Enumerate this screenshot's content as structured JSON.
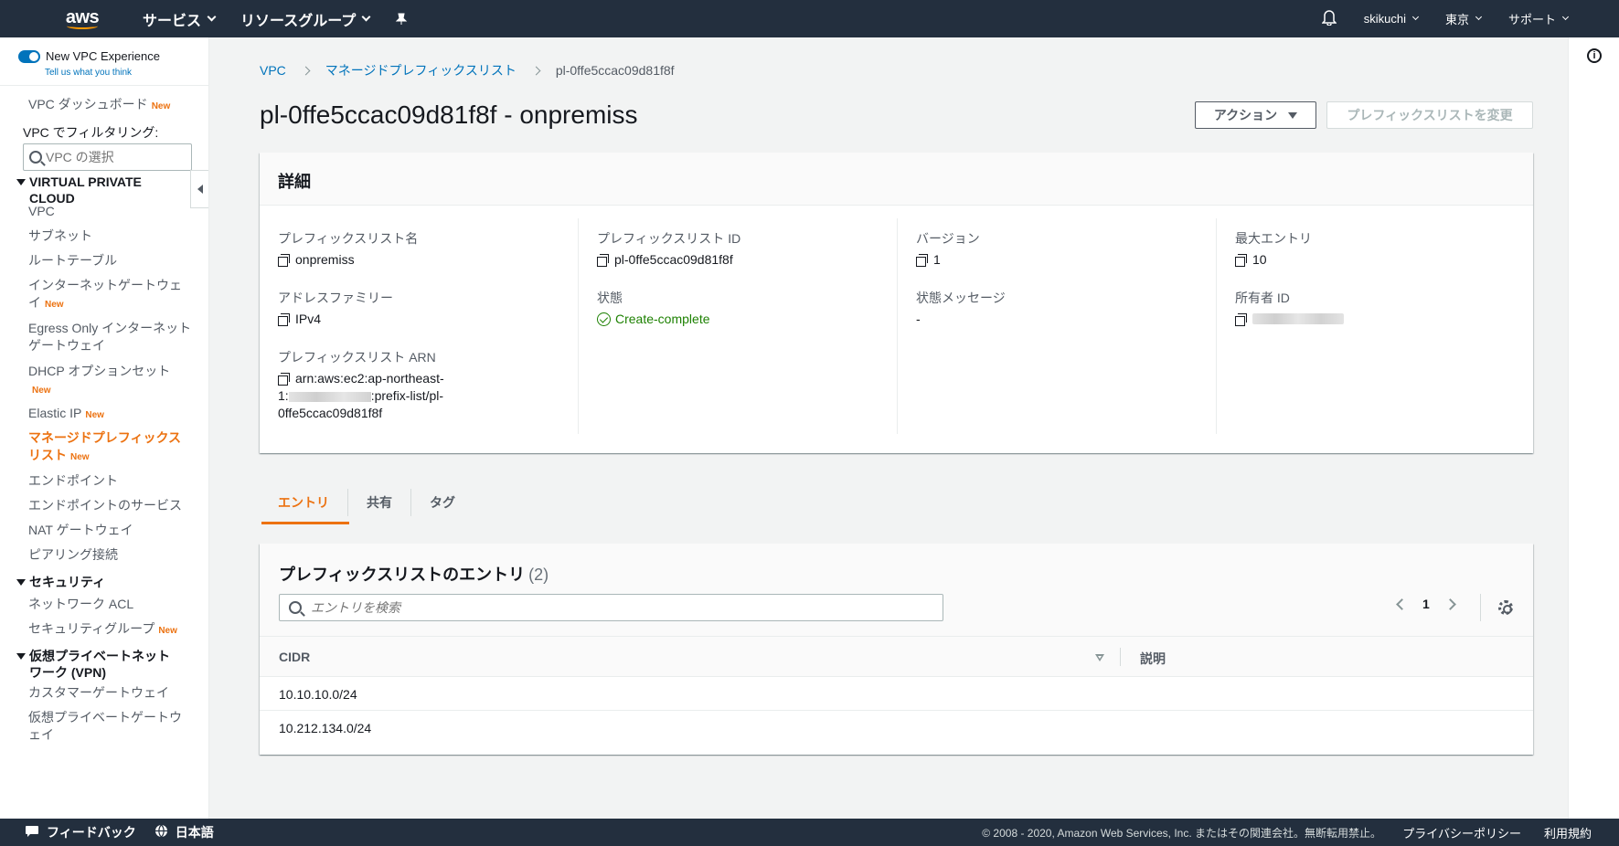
{
  "topnav": {
    "logo": "aws",
    "services": "サービス",
    "resource_groups": "リソースグループ",
    "user": "skikuchi",
    "region": "東京",
    "support": "サポート"
  },
  "sidebar": {
    "new_experience": "New VPC Experience",
    "feedback": "Tell us what you think",
    "dashboard": "VPC ダッシュボード",
    "new_badge": "New",
    "filter_label": "VPC でフィルタリング:",
    "filter_placeholder": "VPC の選択",
    "section_vpc": "VIRTUAL PRIVATE CLOUD",
    "items_vpc": [
      "VPC",
      "サブネット",
      "ルートテーブル",
      "インターネットゲートウェイ",
      "Egress Only インターネットゲートウェイ",
      "DHCP オプションセット",
      "Elastic IP",
      "マネージドプレフィックスリスト",
      "エンドポイント",
      "エンドポイントのサービス",
      "NAT ゲートウェイ",
      "ピアリング接続"
    ],
    "section_security": "セキュリティ",
    "items_security": [
      "ネットワーク ACL",
      "セキュリティグループ"
    ],
    "section_vpn": "仮想プライベートネットワーク (VPN)",
    "items_vpn": [
      "カスタマーゲートウェイ",
      "仮想プライベートゲートウェイ"
    ]
  },
  "breadcrumb": {
    "vpc": "VPC",
    "list": "マネージドプレフィックスリスト",
    "current": "pl-0ffe5ccac09d81f8f"
  },
  "title": "pl-0ffe5ccac09d81f8f - onpremiss",
  "buttons": {
    "actions": "アクション",
    "modify": "プレフィックスリストを変更"
  },
  "details": {
    "heading": "詳細",
    "name_label": "プレフィックスリスト名",
    "name_value": "onpremiss",
    "family_label": "アドレスファミリー",
    "family_value": "IPv4",
    "arn_label": "プレフィックスリスト ARN",
    "arn_line1": "arn:aws:ec2:ap-northeast-",
    "arn_line2_prefix": "1:",
    "arn_line2_suffix": ":prefix-list/pl-",
    "arn_line3": "0ffe5ccac09d81f8f",
    "id_label": "プレフィックスリスト ID",
    "id_value": "pl-0ffe5ccac09d81f8f",
    "state_label": "状態",
    "state_value": "Create-complete",
    "version_label": "バージョン",
    "version_value": "1",
    "message_label": "状態メッセージ",
    "message_value": "-",
    "max_label": "最大エントリ",
    "max_value": "10",
    "owner_label": "所有者 ID"
  },
  "tabs": [
    "エントリ",
    "共有",
    "タグ"
  ],
  "entries": {
    "title": "プレフィックスリストのエントリ",
    "count": "(2)",
    "search_placeholder": "エントリを検索",
    "page": "1",
    "columns": [
      "CIDR",
      "説明"
    ],
    "rows": [
      {
        "cidr": "10.10.10.0/24",
        "description": ""
      },
      {
        "cidr": "10.212.134.0/24",
        "description": ""
      }
    ]
  },
  "footer": {
    "feedback": "フィードバック",
    "language": "日本語",
    "copyright": "© 2008 - 2020, Amazon Web Services, Inc. またはその関連会社。無断転用禁止。",
    "privacy": "プライバシーポリシー",
    "terms": "利用規約"
  },
  "colors": {
    "nav_bg": "#232f3e",
    "accent": "#ec7211",
    "link": "#0073bb",
    "success": "#1d8102"
  }
}
